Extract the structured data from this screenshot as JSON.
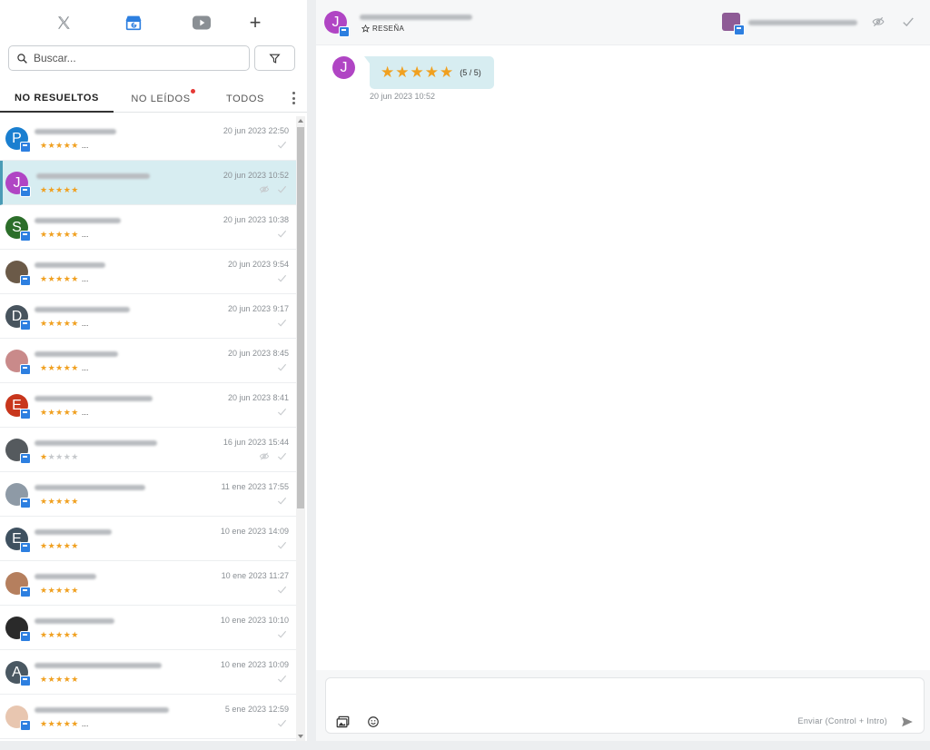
{
  "topnav": {
    "plus_label": "+"
  },
  "search": {
    "placeholder": "Buscar..."
  },
  "tabs": [
    {
      "label": "NO RESUELTOS",
      "active": true
    },
    {
      "label": "NO LEÍDOS",
      "unread_dot": true
    },
    {
      "label": "TODOS"
    }
  ],
  "reviews": [
    {
      "initial": "P",
      "date": "20 jun 2023 22:50",
      "stars": "★★★★★",
      "ellipsis": "..."
    },
    {
      "initial": "J",
      "date": "20 jun 2023 10:52",
      "stars": "★★★★★",
      "ellipsis": "",
      "selected": true
    },
    {
      "initial": "S",
      "date": "20 jun 2023 10:38",
      "stars": "★★★★★",
      "ellipsis": "..."
    },
    {
      "initial": "",
      "date": "20 jun 2023 9:54",
      "stars": "★★★★★",
      "ellipsis": "..."
    },
    {
      "initial": "D",
      "date": "20 jun 2023 9:17",
      "stars": "★★★★★",
      "ellipsis": "..."
    },
    {
      "initial": "",
      "date": "20 jun 2023 8:45",
      "stars": "★★★★★",
      "ellipsis": "..."
    },
    {
      "initial": "E",
      "date": "20 jun 2023 8:41",
      "stars": "★★★★★",
      "ellipsis": "..."
    },
    {
      "initial": "",
      "date": "16 jun 2023 15:44",
      "stars_on": "★",
      "stars_off": "★★★★",
      "ellipsis": ""
    },
    {
      "initial": "",
      "date": "11 ene 2023 17:55",
      "stars": "★★★★★",
      "ellipsis": ""
    },
    {
      "initial": "E",
      "date": "10 ene 2023 14:09",
      "stars": "★★★★★",
      "ellipsis": ""
    },
    {
      "initial": "",
      "date": "10 ene 2023 11:27",
      "stars": "★★★★★",
      "ellipsis": ""
    },
    {
      "initial": "",
      "date": "10 ene 2023 10:10",
      "stars": "★★★★★",
      "ellipsis": ""
    },
    {
      "initial": "A",
      "date": "10 ene 2023 10:09",
      "stars": "★★★★★",
      "ellipsis": ""
    },
    {
      "initial": "",
      "date": "5 ene 2023 12:59",
      "stars": "★★★★★",
      "ellipsis": "..."
    }
  ],
  "conversation": {
    "initial": "J",
    "type_label": "RESEÑA",
    "message": {
      "stars": "★★★★★",
      "rating_text": "(5 / 5)",
      "rating": 5,
      "rating_max": 5,
      "date": "20 jun 2023 10:52"
    }
  },
  "composer": {
    "send_hint": "Enviar (Control + Intro)"
  },
  "colors": {
    "accent": "#2d7fe0",
    "star": "#f0a020",
    "selected_row": "#d7edf1",
    "unread_dot": "#e53935"
  }
}
